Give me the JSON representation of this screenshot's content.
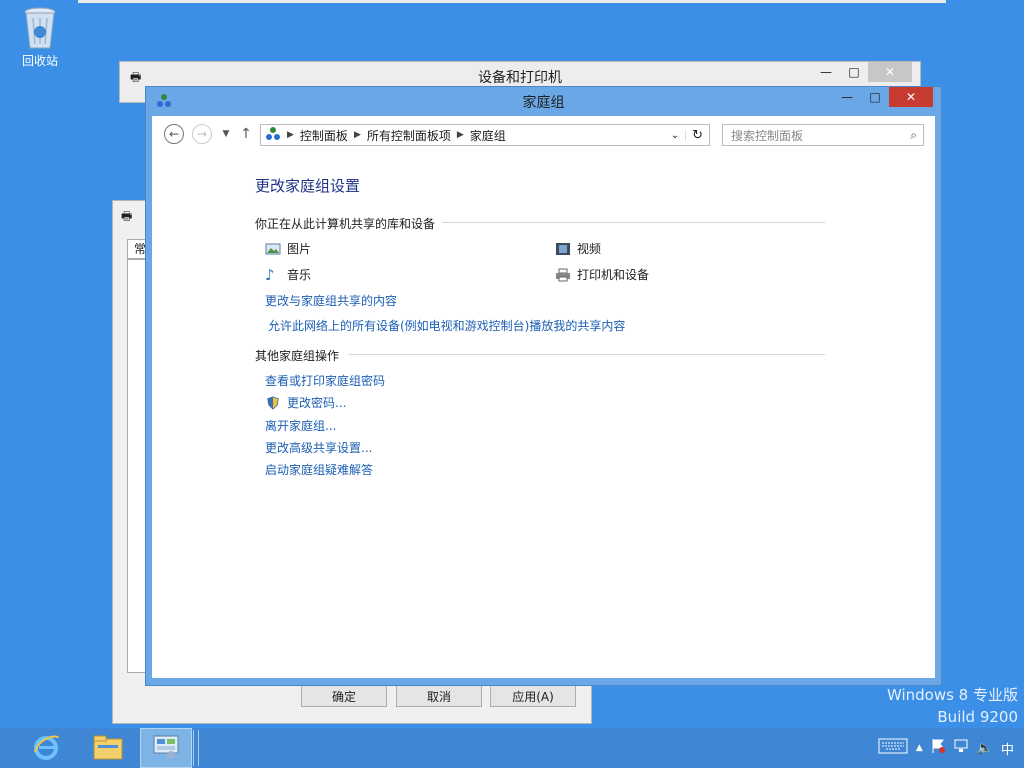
{
  "desktop": {
    "recycle_bin_label": "回收站",
    "watermark": {
      "line1": "Windows 8 专业版",
      "line2": "Build 9200"
    }
  },
  "devices_window": {
    "title": "设备和打印机"
  },
  "props_dialog": {
    "tab_fragment": "常",
    "buttons": {
      "ok": "确定",
      "cancel": "取消",
      "apply": "应用(A)"
    }
  },
  "homegroup_window": {
    "title": "家庭组",
    "caption": {
      "min": "—",
      "max": "□",
      "close": "✕"
    },
    "address": {
      "crumbs": [
        "控制面板",
        "所有控制面板项",
        "家庭组"
      ]
    },
    "search": {
      "placeholder": "搜索控制面板"
    },
    "heading": "更改家庭组设置",
    "shared_section": {
      "label": "你正在从此计算机共享的库和设备",
      "items": [
        {
          "label": "图片",
          "icon": "pictures-icon"
        },
        {
          "label": "视频",
          "icon": "video-icon"
        },
        {
          "label": "音乐",
          "icon": "music-icon"
        },
        {
          "label": "打印机和设备",
          "icon": "printer-icon"
        }
      ],
      "links": [
        "更改与家庭组共享的内容",
        "允许此网络上的所有设备(例如电视和游戏控制台)播放我的共享内容"
      ]
    },
    "other_section": {
      "label": "其他家庭组操作",
      "links": [
        "查看或打印家庭组密码",
        "更改密码...",
        "离开家庭组...",
        "更改高级共享设置...",
        "启动家庭组疑难解答"
      ]
    }
  },
  "taskbar": {
    "tray": {
      "ime": "中"
    }
  }
}
